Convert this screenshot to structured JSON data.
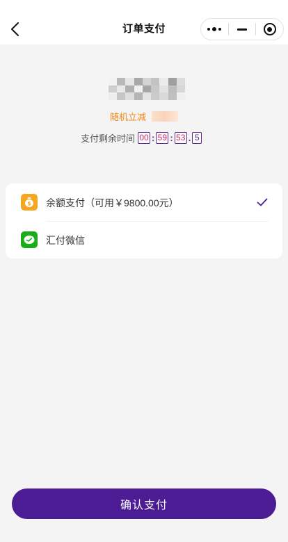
{
  "navbar": {
    "title": "订单支付",
    "back_icon": "chevron-left-icon",
    "capsule_icons": [
      "more-dots-icon",
      "minimize-icon",
      "target-icon"
    ]
  },
  "order": {
    "discount_label": "随机立减",
    "countdown_label": "支付剩余时间",
    "countdown": {
      "hours": "00",
      "minutes": "59",
      "seconds": "53",
      "tenths": "5"
    }
  },
  "payment_methods": [
    {
      "label": "余额支付（可用￥9800.00元）",
      "icon": "wallet-icon",
      "selected": true
    },
    {
      "label": "汇付微信",
      "icon": "wechat-icon",
      "selected": false
    }
  ],
  "confirm_label": "确认支付",
  "colors": {
    "accent": "#4b1c93",
    "discount": "#f28a1c",
    "countdown_digit": "#d0246b",
    "balance_icon": "#f5a623",
    "wechat_icon": "#1aad19",
    "background": "#f4f4f5"
  }
}
